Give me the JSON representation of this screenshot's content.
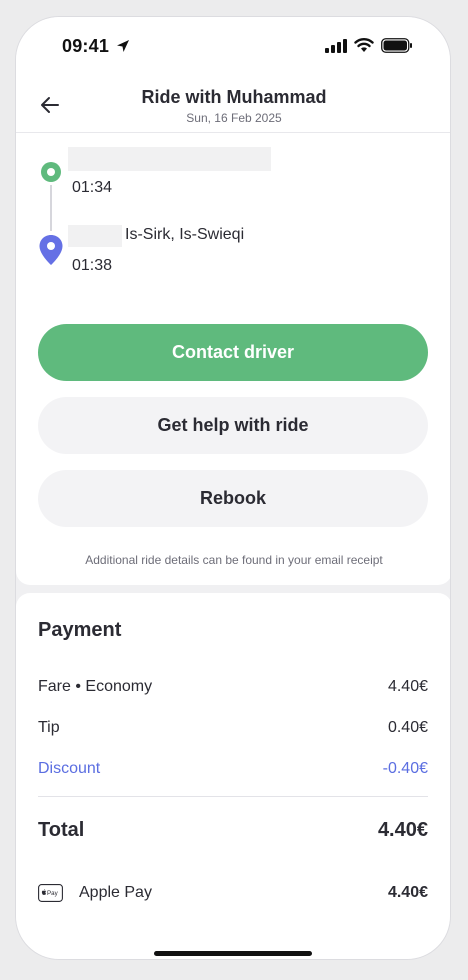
{
  "status_bar": {
    "time": "09:41"
  },
  "header": {
    "title": "Ride with Muhammad",
    "date": "Sun, 16 Feb 2025"
  },
  "route": {
    "pickup_time": "01:34",
    "dropoff_address": "Is-Sirk, Is-Swieqi",
    "dropoff_time": "01:38"
  },
  "actions": {
    "contact_driver": "Contact driver",
    "get_help": "Get help with ride",
    "rebook": "Rebook"
  },
  "note": "Additional ride details can be found in your email receipt",
  "payment": {
    "title": "Payment",
    "rows": [
      {
        "label": "Fare • Economy",
        "value": "4.40€"
      },
      {
        "label": "Tip",
        "value": "0.40€"
      },
      {
        "label": "Discount",
        "value": "-0.40€"
      }
    ],
    "total_label": "Total",
    "total_value": "4.40€",
    "method_label": "Apple Pay",
    "method_value": "4.40€"
  },
  "colors": {
    "accent_green": "#5fba7d",
    "discount_blue": "#5b6ee1",
    "pin_purple": "#6570e5"
  }
}
